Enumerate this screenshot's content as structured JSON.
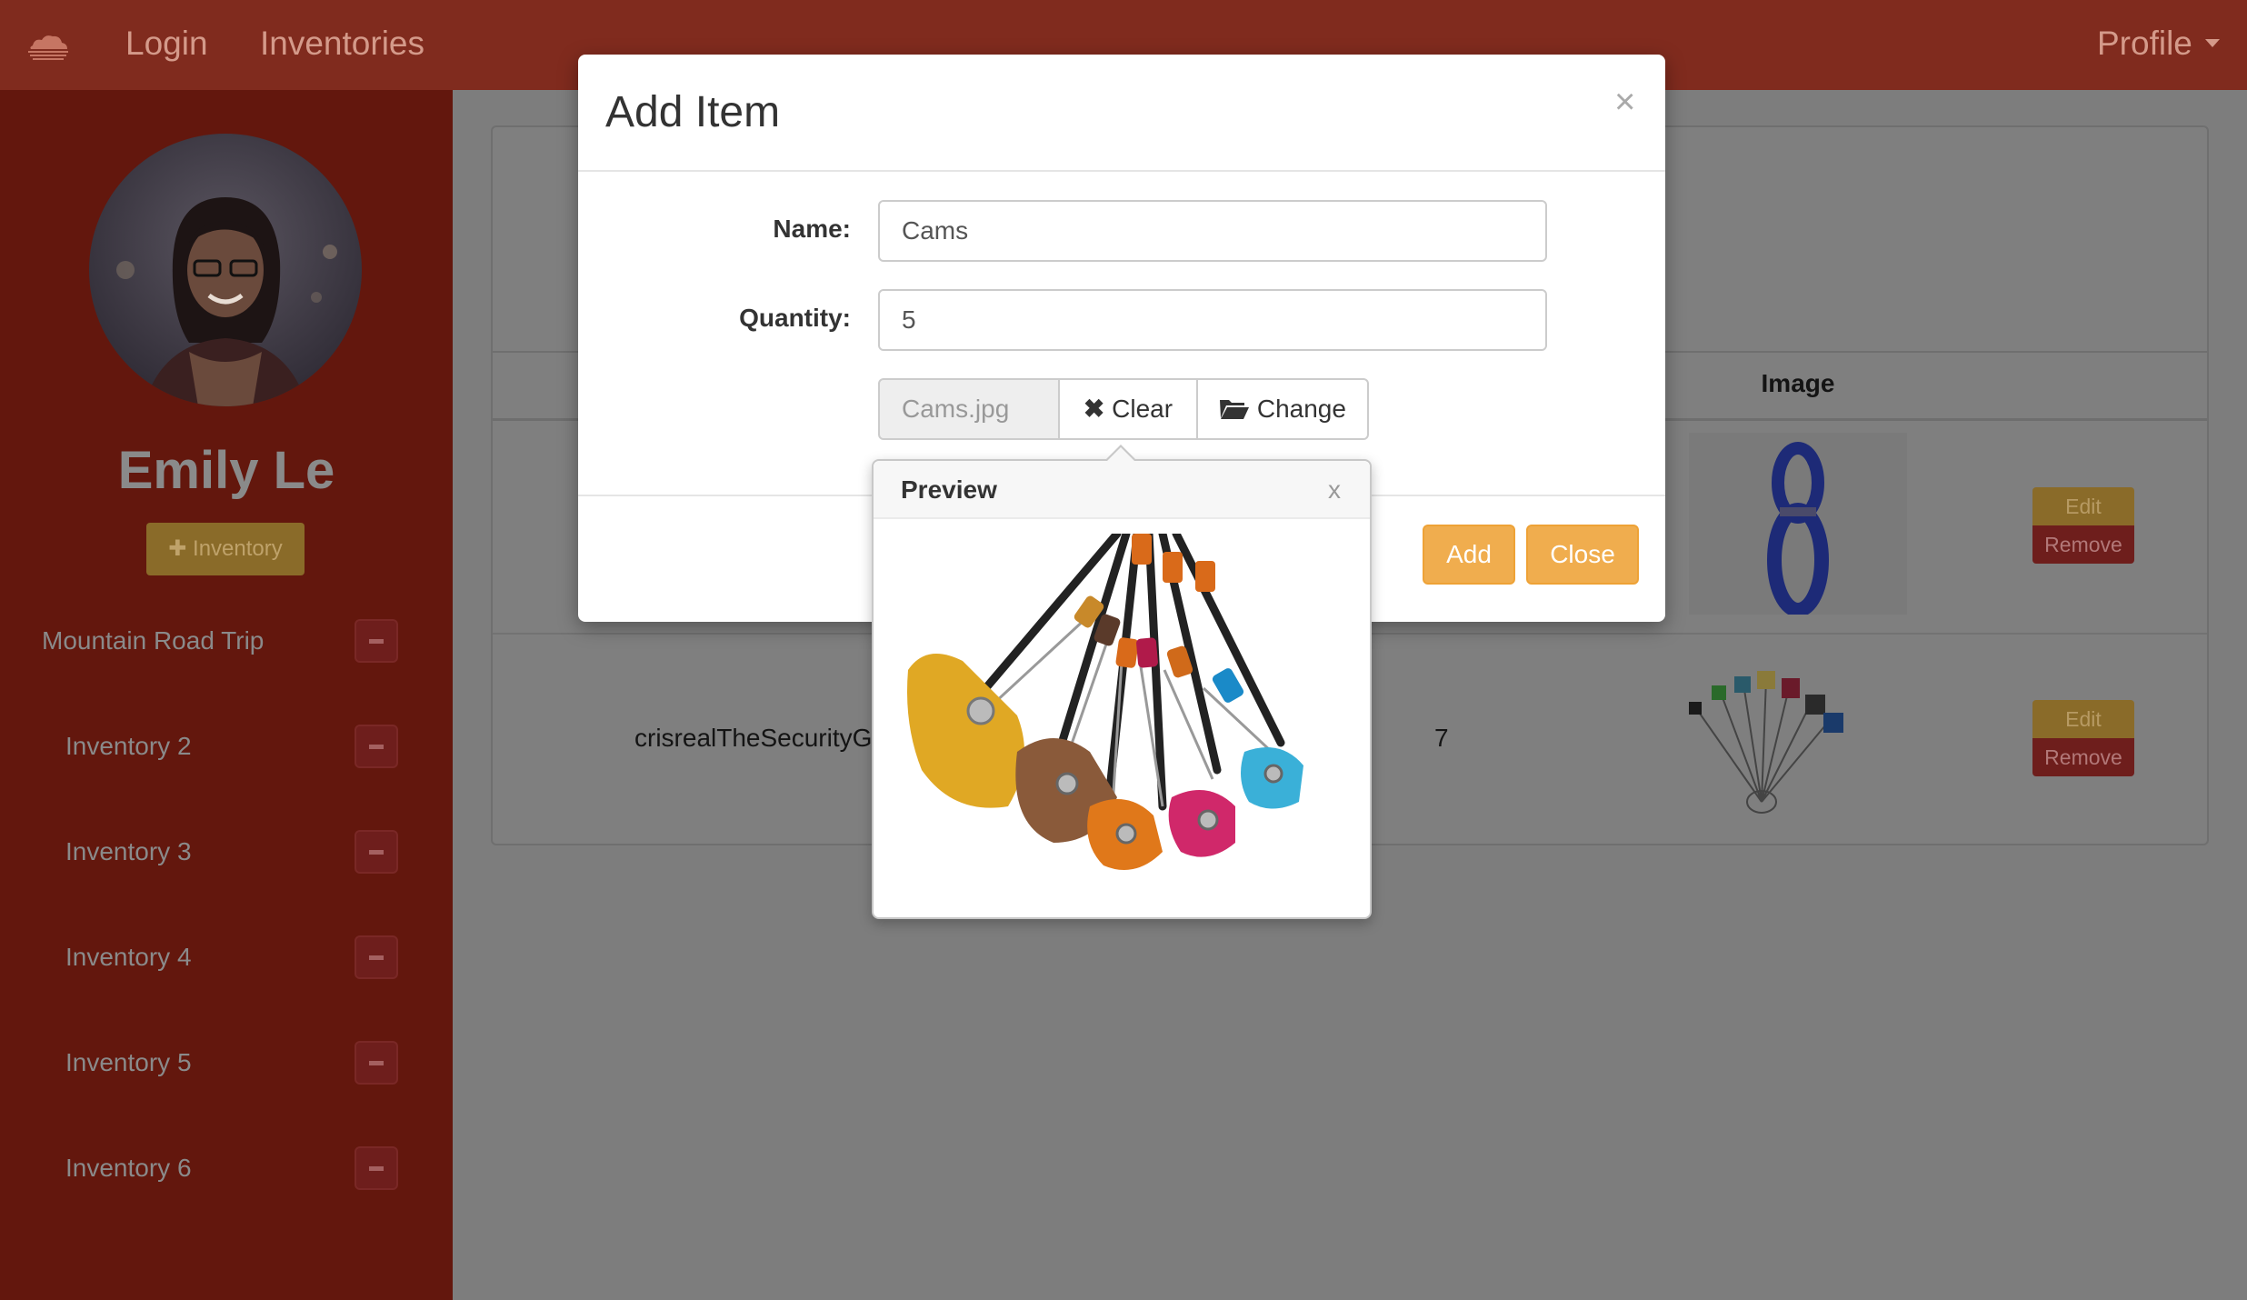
{
  "navbar": {
    "brand_icon": "cloud-logo-icon",
    "login": "Login",
    "inventories": "Inventories",
    "profile": "Profile"
  },
  "sidebar": {
    "user_name": "Emily Le",
    "add_inventory_label": "Inventory",
    "inventories": [
      {
        "label": "Mountain Road Trip"
      },
      {
        "label": "Inventory 2"
      },
      {
        "label": "Inventory 3"
      },
      {
        "label": "Inventory 4"
      },
      {
        "label": "Inventory 5"
      },
      {
        "label": "Inventory 6"
      }
    ]
  },
  "table": {
    "image_header": "Image",
    "rows": [
      {
        "name": "",
        "quantity": "",
        "edit": "Edit",
        "remove": "Remove"
      },
      {
        "name": "crisrealTheSecurityG",
        "quantity": "7",
        "edit": "Edit",
        "remove": "Remove"
      }
    ]
  },
  "modal": {
    "title": "Add Item",
    "close_symbol": "×",
    "name_label": "Name:",
    "name_value": "Cams",
    "quantity_label": "Quantity:",
    "quantity_value": "5",
    "file_name": "Cams.jpg",
    "clear_label": "Clear",
    "change_label": "Change",
    "add_button": "Add",
    "close_button": "Close"
  },
  "preview": {
    "title": "Preview",
    "close_symbol": "x"
  },
  "colors": {
    "navbar": "#802b1e",
    "sidebar": "#63170d",
    "warning": "#f0ad4e",
    "danger": "#6e1e1c"
  }
}
